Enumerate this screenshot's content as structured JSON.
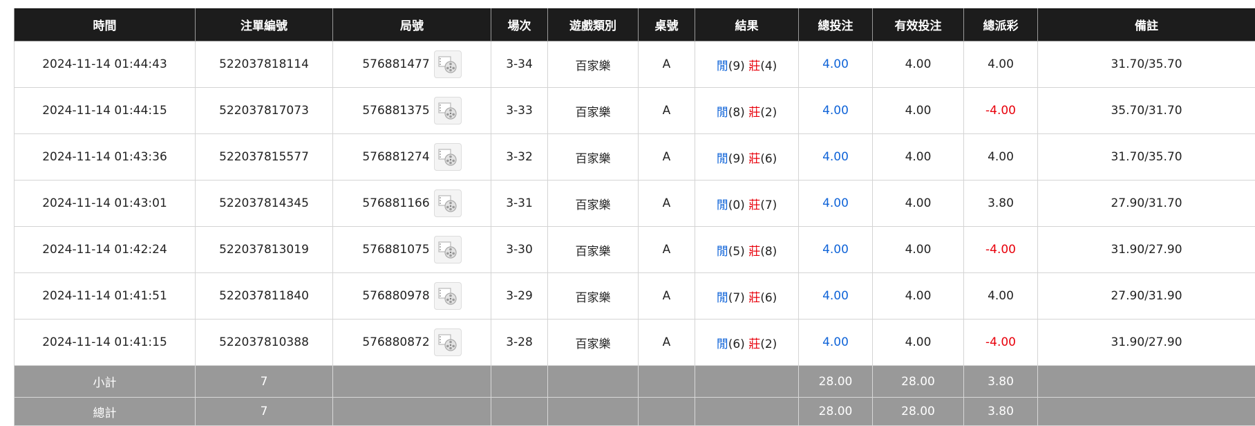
{
  "table": {
    "headers": [
      "時間",
      "注單編號",
      "局號",
      "場次",
      "遊戲類別",
      "桌號",
      "結果",
      "總投注",
      "有效投注",
      "總派彩",
      "備註"
    ],
    "rows": [
      {
        "time": "2024-11-14 01:44:43",
        "bet_id": "522037818114",
        "round_id": "576881477",
        "session": "3-34",
        "game": "百家樂",
        "table": "A",
        "player_label": "閒",
        "player_score": "(9)",
        "banker_label": "莊",
        "banker_score": "(4)",
        "total_bet": "4.00",
        "valid_bet": "4.00",
        "payout": "4.00",
        "payout_negative": false,
        "note": "31.70/35.70"
      },
      {
        "time": "2024-11-14 01:44:15",
        "bet_id": "522037817073",
        "round_id": "576881375",
        "session": "3-33",
        "game": "百家樂",
        "table": "A",
        "player_label": "閒",
        "player_score": "(8)",
        "banker_label": "莊",
        "banker_score": "(2)",
        "total_bet": "4.00",
        "valid_bet": "4.00",
        "payout": "-4.00",
        "payout_negative": true,
        "note": "35.70/31.70"
      },
      {
        "time": "2024-11-14 01:43:36",
        "bet_id": "522037815577",
        "round_id": "576881274",
        "session": "3-32",
        "game": "百家樂",
        "table": "A",
        "player_label": "閒",
        "player_score": "(9)",
        "banker_label": "莊",
        "banker_score": "(6)",
        "total_bet": "4.00",
        "valid_bet": "4.00",
        "payout": "4.00",
        "payout_negative": false,
        "note": "31.70/35.70"
      },
      {
        "time": "2024-11-14 01:43:01",
        "bet_id": "522037814345",
        "round_id": "576881166",
        "session": "3-31",
        "game": "百家樂",
        "table": "A",
        "player_label": "閒",
        "player_score": "(0)",
        "banker_label": "莊",
        "banker_score": "(7)",
        "total_bet": "4.00",
        "valid_bet": "4.00",
        "payout": "3.80",
        "payout_negative": false,
        "note": "27.90/31.70"
      },
      {
        "time": "2024-11-14 01:42:24",
        "bet_id": "522037813019",
        "round_id": "576881075",
        "session": "3-30",
        "game": "百家樂",
        "table": "A",
        "player_label": "閒",
        "player_score": "(5)",
        "banker_label": "莊",
        "banker_score": "(8)",
        "total_bet": "4.00",
        "valid_bet": "4.00",
        "payout": "-4.00",
        "payout_negative": true,
        "note": "31.90/27.90"
      },
      {
        "time": "2024-11-14 01:41:51",
        "bet_id": "522037811840",
        "round_id": "576880978",
        "session": "3-29",
        "game": "百家樂",
        "table": "A",
        "player_label": "閒",
        "player_score": "(7)",
        "banker_label": "莊",
        "banker_score": "(6)",
        "total_bet": "4.00",
        "valid_bet": "4.00",
        "payout": "4.00",
        "payout_negative": false,
        "note": "27.90/31.90"
      },
      {
        "time": "2024-11-14 01:41:15",
        "bet_id": "522037810388",
        "round_id": "576880872",
        "session": "3-28",
        "game": "百家樂",
        "table": "A",
        "player_label": "閒",
        "player_score": "(6)",
        "banker_label": "莊",
        "banker_score": "(2)",
        "total_bet": "4.00",
        "valid_bet": "4.00",
        "payout": "-4.00",
        "payout_negative": true,
        "note": "31.90/27.90"
      }
    ],
    "subtotal": {
      "label": "小計",
      "count": "7",
      "total_bet": "28.00",
      "valid_bet": "28.00",
      "payout": "3.80"
    },
    "grand_total": {
      "label": "總計",
      "count": "7",
      "total_bet": "28.00",
      "valid_bet": "28.00",
      "payout": "3.80"
    }
  },
  "icons": {
    "replay": "film-reel-icon"
  },
  "colors": {
    "header_bg": "#1c1c1c",
    "summary_bg": "#999999",
    "player": "#1064d8",
    "banker": "#e8000b",
    "negative": "#e8000b"
  }
}
